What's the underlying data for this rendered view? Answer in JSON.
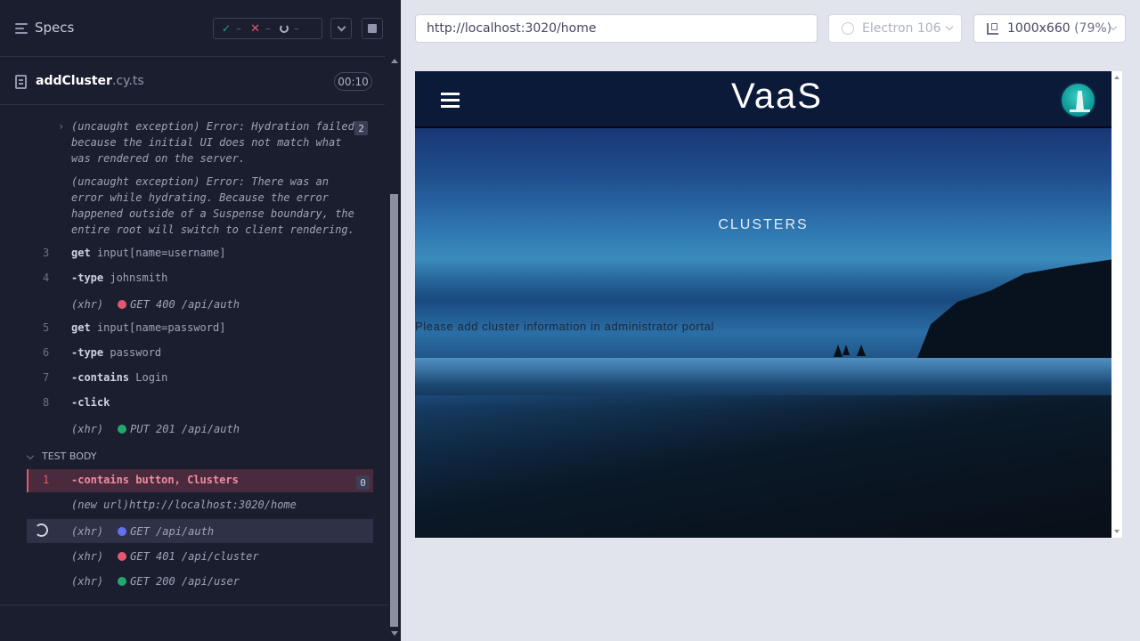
{
  "reporter": {
    "title": "Specs",
    "stats": {
      "passed": "–",
      "failed": "–",
      "pending": "–"
    },
    "spec_file": {
      "name": "addCluster",
      "ext": ".cy.ts",
      "duration": "00:10"
    },
    "errors": [
      {
        "text": "(uncaught exception)  Error: Hydration failed because the initial UI does not match what was rendered on the server.",
        "count": "2"
      },
      {
        "text": "(uncaught exception)  Error: There was an error while hydrating. Because the error happened outside of a Suspense boundary, the entire root will switch to client rendering."
      }
    ],
    "commands": [
      {
        "num": "3",
        "name": "get",
        "arg": "input[name=username]"
      },
      {
        "num": "4",
        "name": "-type",
        "arg": "johnsmith"
      },
      {
        "num": "",
        "name": "(xhr)",
        "arg": "GET 400 /api/auth",
        "status": "fail"
      },
      {
        "num": "5",
        "name": "get",
        "arg": "input[name=password]"
      },
      {
        "num": "6",
        "name": "-type",
        "arg": "password"
      },
      {
        "num": "7",
        "name": "-contains",
        "arg": "Login"
      },
      {
        "num": "8",
        "name": "-click",
        "arg": ""
      },
      {
        "num": "",
        "name": "(xhr)",
        "arg": "PUT 201 /api/auth",
        "status": "ok"
      }
    ],
    "test_body_label": "TEST BODY",
    "test_body": [
      {
        "num": "1",
        "name": "-contains",
        "arg": "button, Clusters",
        "badge": "0"
      },
      {
        "num": "",
        "name": "(new url)",
        "arg": "http://localhost:3020/home"
      },
      {
        "num": "",
        "name": "(xhr)",
        "arg": "GET /api/auth",
        "status": "pending"
      },
      {
        "num": "",
        "name": "(xhr)",
        "arg": "GET 401 /api/cluster",
        "status": "fail"
      },
      {
        "num": "",
        "name": "(xhr)",
        "arg": "GET 200 /api/user",
        "status": "ok"
      }
    ]
  },
  "browser": {
    "url": "http://localhost:3020/home",
    "browser_name": "Electron 106",
    "viewport_size": "1000x660",
    "viewport_scale": "(79%)"
  },
  "app": {
    "title": "VaaS",
    "heading": "CLUSTERS",
    "message": "Please add cluster information in administrator portal"
  },
  "colors": {
    "fail": "#e45770",
    "ok": "#1fa971",
    "pending": "#6470f0"
  }
}
